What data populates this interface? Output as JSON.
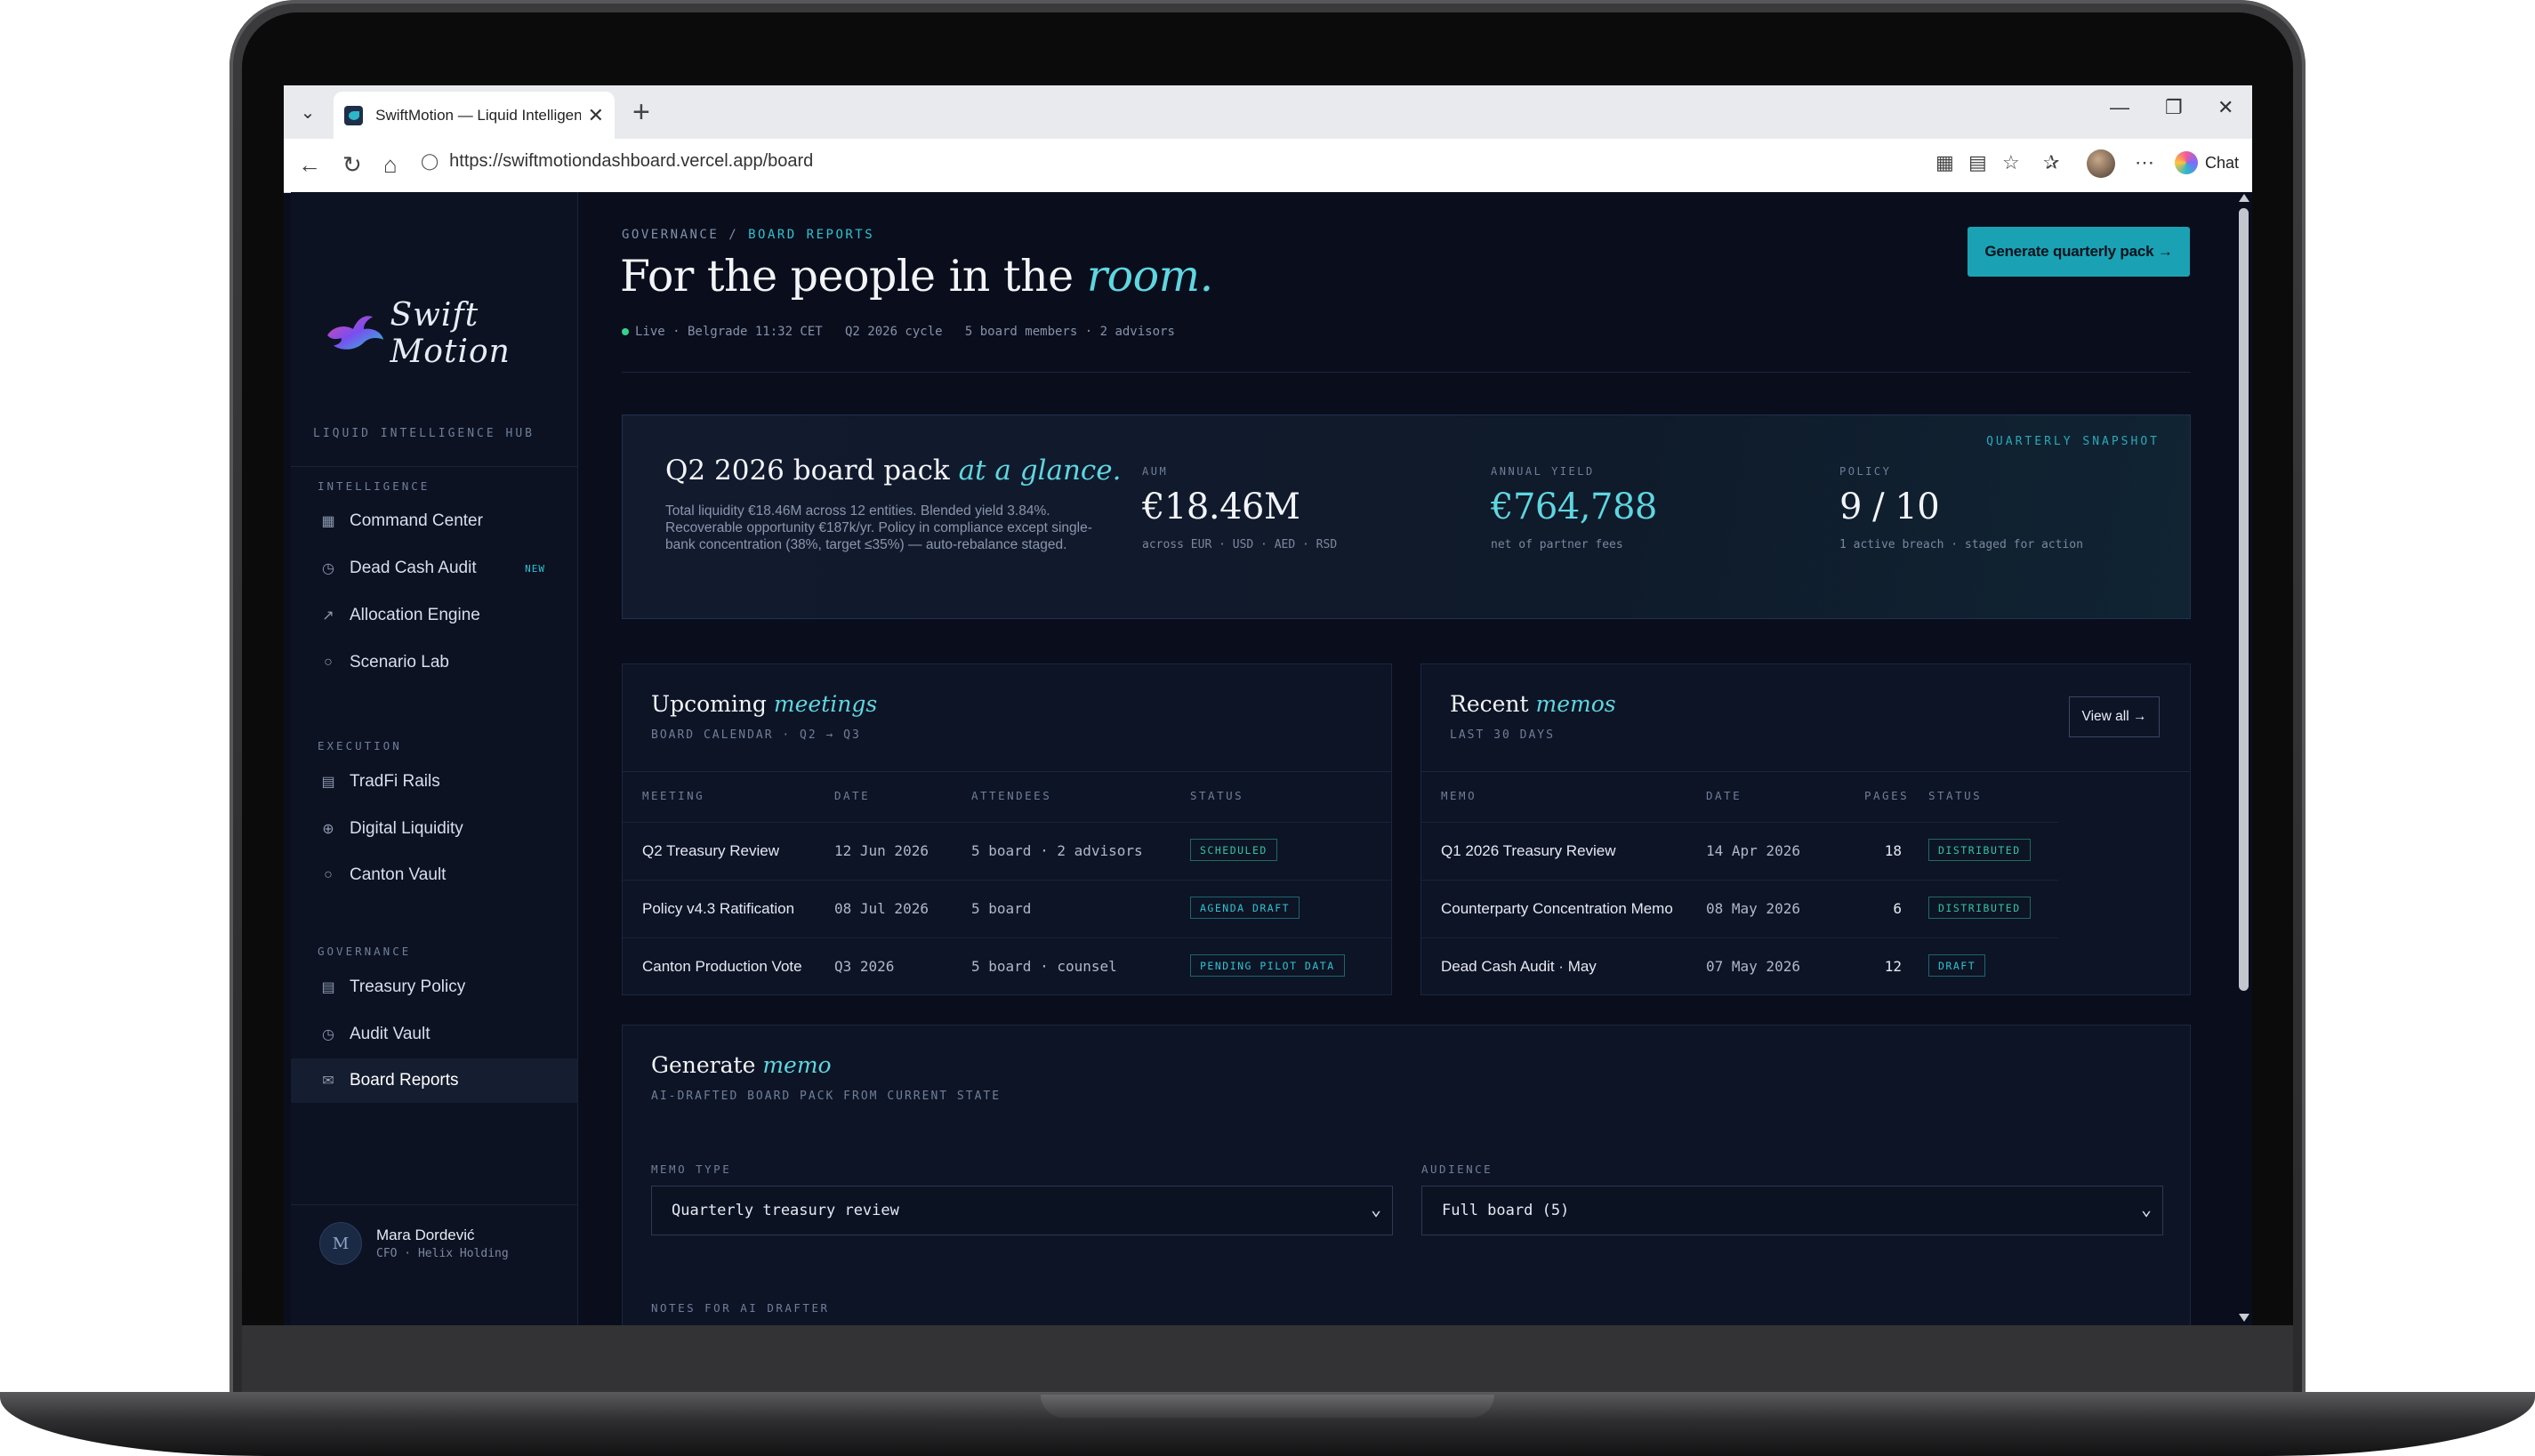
{
  "browser": {
    "tab_title": "SwiftMotion — Liquid Intelligence",
    "tab_close": "✕",
    "new_tab": "+",
    "url": "https://swiftmotiondashboard.vercel.app/board",
    "chat_label": "Chat"
  },
  "sidebar": {
    "brand": "Swift Motion",
    "hub_label": "LIQUID INTELLIGENCE HUB",
    "sections": [
      {
        "label": "INTELLIGENCE",
        "items": [
          {
            "label": "Command Center",
            "icon": "grid-icon"
          },
          {
            "label": "Dead Cash Audit",
            "icon": "clock-icon",
            "badge": "NEW"
          },
          {
            "label": "Allocation Engine",
            "icon": "trend-icon"
          },
          {
            "label": "Scenario Lab",
            "icon": "flask-icon"
          }
        ]
      },
      {
        "label": "EXECUTION",
        "items": [
          {
            "label": "TradFi Rails",
            "icon": "bank-icon"
          },
          {
            "label": "Digital Liquidity",
            "icon": "globe-icon"
          },
          {
            "label": "Canton Vault",
            "icon": "circle-icon"
          }
        ]
      },
      {
        "label": "GOVERNANCE",
        "items": [
          {
            "label": "Treasury Policy",
            "icon": "doc-icon"
          },
          {
            "label": "Audit Vault",
            "icon": "clock-icon"
          },
          {
            "label": "Board Reports",
            "icon": "mail-icon",
            "active": true
          }
        ]
      }
    ],
    "user": {
      "initial": "M",
      "name": "Mara Dordević",
      "role": "CFO · Helix Holding"
    }
  },
  "header": {
    "breadcrumb_parent": "GOVERNANCE",
    "breadcrumb_sep": " / ",
    "breadcrumb_current": "BOARD REPORTS",
    "title_main": "For the people in the ",
    "title_accent": "room.",
    "status": "Live · Belgrade 11:32 CET   Q2 2026 cycle   5 board members · 2 advisors",
    "cta": "Generate quarterly pack →"
  },
  "snapshot": {
    "tag": "QUARTERLY SNAPSHOT",
    "title_main": "Q2 2026 board pack ",
    "title_accent": "at a glance.",
    "description": "Total liquidity €18.46M across 12 entities. Blended yield 3.84%. Recoverable opportunity €187k/yr. Policy in compliance except single-bank concentration (38%, target ≤35%) — auto-rebalance staged.",
    "kpis": [
      {
        "label": "AUM",
        "value": "€18.46M",
        "sub": "across EUR · USD · AED · RSD",
        "accent": false
      },
      {
        "label": "ANNUAL YIELD",
        "value": "€764,788",
        "sub": "net of partner fees",
        "accent": true
      },
      {
        "label": "POLICY",
        "value": "9 / 10",
        "sub": "1 active breach · staged for action",
        "accent": false
      }
    ]
  },
  "meetings": {
    "title_main": "Upcoming ",
    "title_accent": "meetings",
    "subtitle": "BOARD CALENDAR · Q2 → Q3",
    "columns": [
      "MEETING",
      "DATE",
      "ATTENDEES",
      "STATUS"
    ],
    "rows": [
      {
        "meeting": "Q2 Treasury Review",
        "date": "12 Jun 2026",
        "attendees": "5 board · 2 advisors",
        "status": "SCHEDULED"
      },
      {
        "meeting": "Policy v4.3 Ratification",
        "date": "08 Jul 2026",
        "attendees": "5 board",
        "status": "AGENDA DRAFT"
      },
      {
        "meeting": "Canton Production Vote",
        "date": "Q3 2026",
        "attendees": "5 board · counsel",
        "status": "PENDING PILOT DATA"
      }
    ]
  },
  "memos": {
    "title_main": "Recent ",
    "title_accent": "memos",
    "subtitle": "LAST 30 DAYS",
    "view_all": "View all →",
    "columns": [
      "MEMO",
      "DATE",
      "PAGES",
      "STATUS"
    ],
    "rows": [
      {
        "memo": "Q1 2026 Treasury Review",
        "date": "14 Apr 2026",
        "pages": "18",
        "status": "DISTRIBUTED"
      },
      {
        "memo": "Counterparty Concentration Memo",
        "date": "08 May 2026",
        "pages": "6",
        "status": "DISTRIBUTED"
      },
      {
        "memo": "Dead Cash Audit · May",
        "date": "07 May 2026",
        "pages": "12",
        "status": "DRAFT"
      }
    ]
  },
  "generate": {
    "title_main": "Generate ",
    "title_accent": "memo",
    "subtitle": "AI-DRAFTED BOARD PACK FROM CURRENT STATE",
    "memo_type_label": "MEMO TYPE",
    "memo_type_value": "Quarterly treasury review",
    "audience_label": "AUDIENCE",
    "audience_value": "Full board (5)",
    "notes_label": "NOTES FOR AI DRAFTER"
  },
  "colors": {
    "accent": "#5fd6e0",
    "cta": "#1aa2b4",
    "bg": "#0a0e1c",
    "status_green": "#33c3a3"
  }
}
